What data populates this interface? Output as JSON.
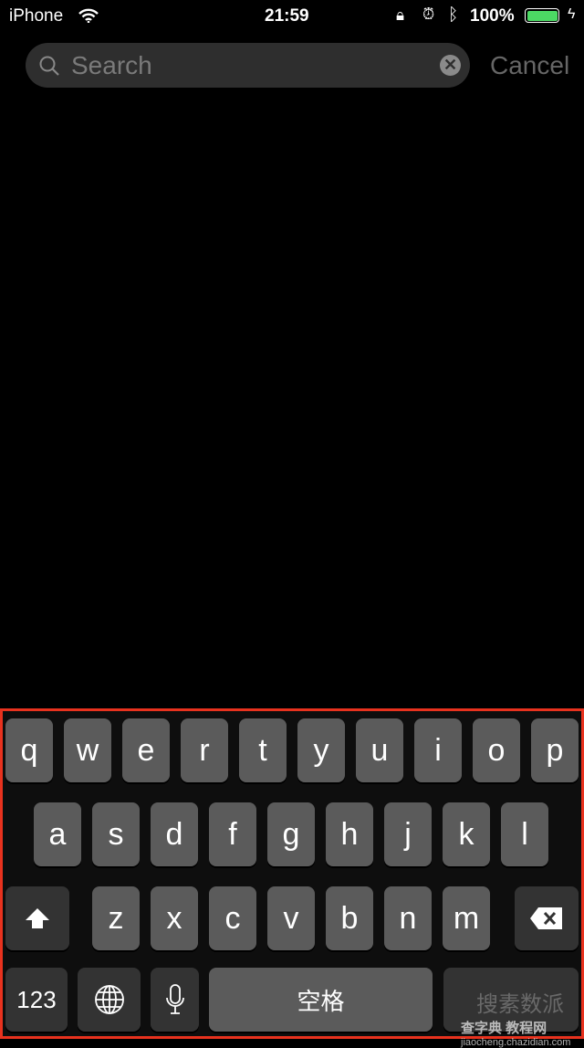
{
  "status_bar": {
    "carrier": "iPhone",
    "time": "21:59",
    "battery": "100%",
    "battery_color": "#4cd964"
  },
  "search": {
    "placeholder": "Search",
    "cancel_label": "Cancel"
  },
  "keyboard": {
    "row1": [
      "q",
      "w",
      "e",
      "r",
      "t",
      "y",
      "u",
      "i",
      "o",
      "p"
    ],
    "row2": [
      "a",
      "s",
      "d",
      "f",
      "g",
      "h",
      "j",
      "k",
      "l"
    ],
    "row3": [
      "z",
      "x",
      "c",
      "v",
      "b",
      "n",
      "m"
    ],
    "numbers_label": "123",
    "space_label": "空格",
    "highlight_color": "#e8321e"
  },
  "watermark": {
    "line1": "搜素数派",
    "line2": "查字典 教程网",
    "url": "jiaocheng.chazidian.com"
  }
}
